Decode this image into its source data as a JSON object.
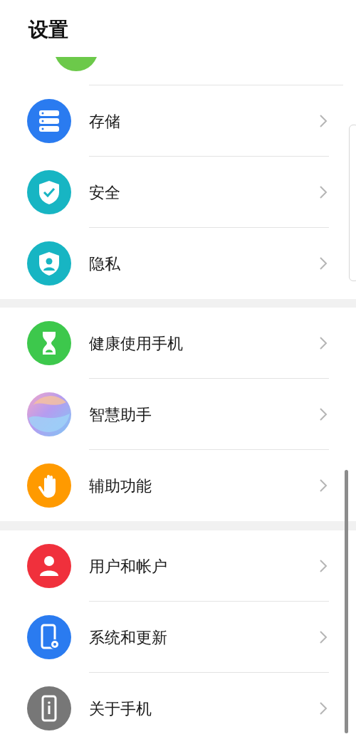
{
  "header": {
    "title": "设置"
  },
  "sections": [
    {
      "items": [
        {
          "kind": "cut"
        },
        {
          "kind": "row",
          "label": "存储"
        },
        {
          "kind": "row",
          "label": "安全"
        },
        {
          "kind": "row",
          "label": "隐私"
        }
      ]
    },
    {
      "items": [
        {
          "kind": "row",
          "label": "健康使用手机"
        },
        {
          "kind": "row",
          "label": "智慧助手"
        },
        {
          "kind": "row",
          "label": "辅助功能"
        }
      ]
    },
    {
      "items": [
        {
          "kind": "row",
          "label": "用户和帐户"
        },
        {
          "kind": "row",
          "label": "系统和更新"
        },
        {
          "kind": "row",
          "label": "关于手机"
        }
      ]
    }
  ]
}
